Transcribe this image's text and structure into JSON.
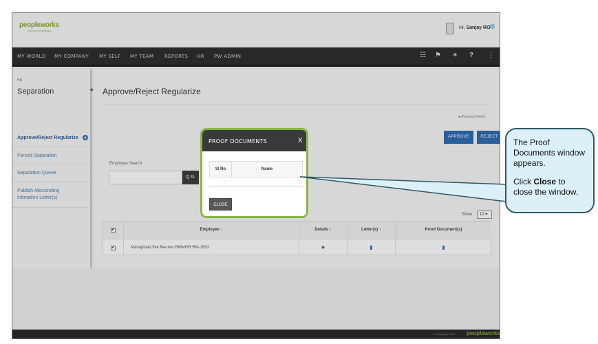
{
  "app": {
    "brand": "peopleworks",
    "brand_tagline": "PEOPLE ENTERPRISES",
    "greeting_prefix": "Hi, ",
    "user_name": "Sanjay RO"
  },
  "nav": {
    "items": [
      "MY WORLD",
      "MY COMPANY",
      "MY SELF",
      "MY TEAM",
      "REPORTS",
      "HR",
      "PW ADMIN"
    ],
    "icons": [
      "book-icon",
      "flag-icon",
      "pin-icon",
      "help-icon",
      "share-icon"
    ],
    "icon_glyphs": [
      "☷",
      "⚑",
      "✶",
      "?",
      "⋮"
    ]
  },
  "sidebar": {
    "section": "HR",
    "title": "Separation",
    "items": [
      {
        "label": "Approve/Reject Regularize",
        "active": true
      },
      {
        "label": "Forced Separation",
        "active": false
      },
      {
        "label": "Separation Queue",
        "active": false
      },
      {
        "label": "Publish Absconding Intimation Letter(s)",
        "active": false
      }
    ]
  },
  "main": {
    "page_title": "Approve/Reject Regularize",
    "required_note": "Required Fields",
    "approve_label": "APPROVE",
    "reject_label": "REJECT",
    "employee_search_label": "Employee Search",
    "employee_search_value": "",
    "search_button_label": "Q G",
    "show_label": "Show",
    "show_value": "10 ▾",
    "grid": {
      "columns": [
        "✔",
        "Employee ↕",
        "Details ↕",
        "Letter(s) ↕",
        "Proof Document(s)"
      ],
      "rows": [
        {
          "checked": "✔",
          "employee": "Manupload five five two RMMGR RM-1502",
          "details_icon": "◉",
          "letters_icon": "▮",
          "proof_icon": "▮"
        }
      ]
    }
  },
  "footer": {
    "copyright": "© Copyright 2015",
    "brand": "peopleworks"
  },
  "modal": {
    "title": "PROOF DOCUMENTS",
    "close_x": "X",
    "columns": [
      "Sl No",
      "Name"
    ],
    "close_button": "CLOSE"
  },
  "callout": {
    "line1": "The Proof Documents window appears.",
    "line2_prefix": "Click ",
    "line2_bold": "Close",
    "line2_suffix": " to close the window."
  },
  "colors": {
    "accent_blue": "#2f6db3",
    "modal_border": "#8ab64a",
    "callout_bg": "#dcf0f8",
    "navbar": "#2e2e2e"
  }
}
